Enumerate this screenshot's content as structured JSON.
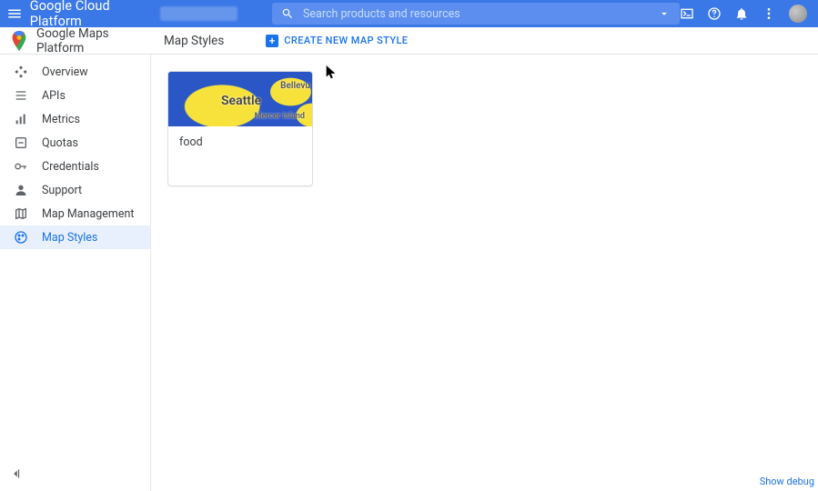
{
  "header": {
    "gcp_title": "Google Cloud Platform",
    "search_placeholder": "Search products and resources"
  },
  "product": {
    "name": "Google Maps Platform"
  },
  "page": {
    "title": "Map Styles",
    "create_btn": "CREATE NEW MAP STYLE"
  },
  "sidebar": {
    "items": [
      {
        "label": "Overview"
      },
      {
        "label": "APIs"
      },
      {
        "label": "Metrics"
      },
      {
        "label": "Quotas"
      },
      {
        "label": "Credentials"
      },
      {
        "label": "Support"
      },
      {
        "label": "Map Management"
      },
      {
        "label": "Map Styles"
      }
    ],
    "active_index": 7
  },
  "card": {
    "title": "food",
    "thumb_labels": {
      "seattle": "Seattle",
      "bellevue": "Bellevu",
      "mercer": "Mercer Island"
    }
  },
  "footer": {
    "debug": "Show debug"
  }
}
